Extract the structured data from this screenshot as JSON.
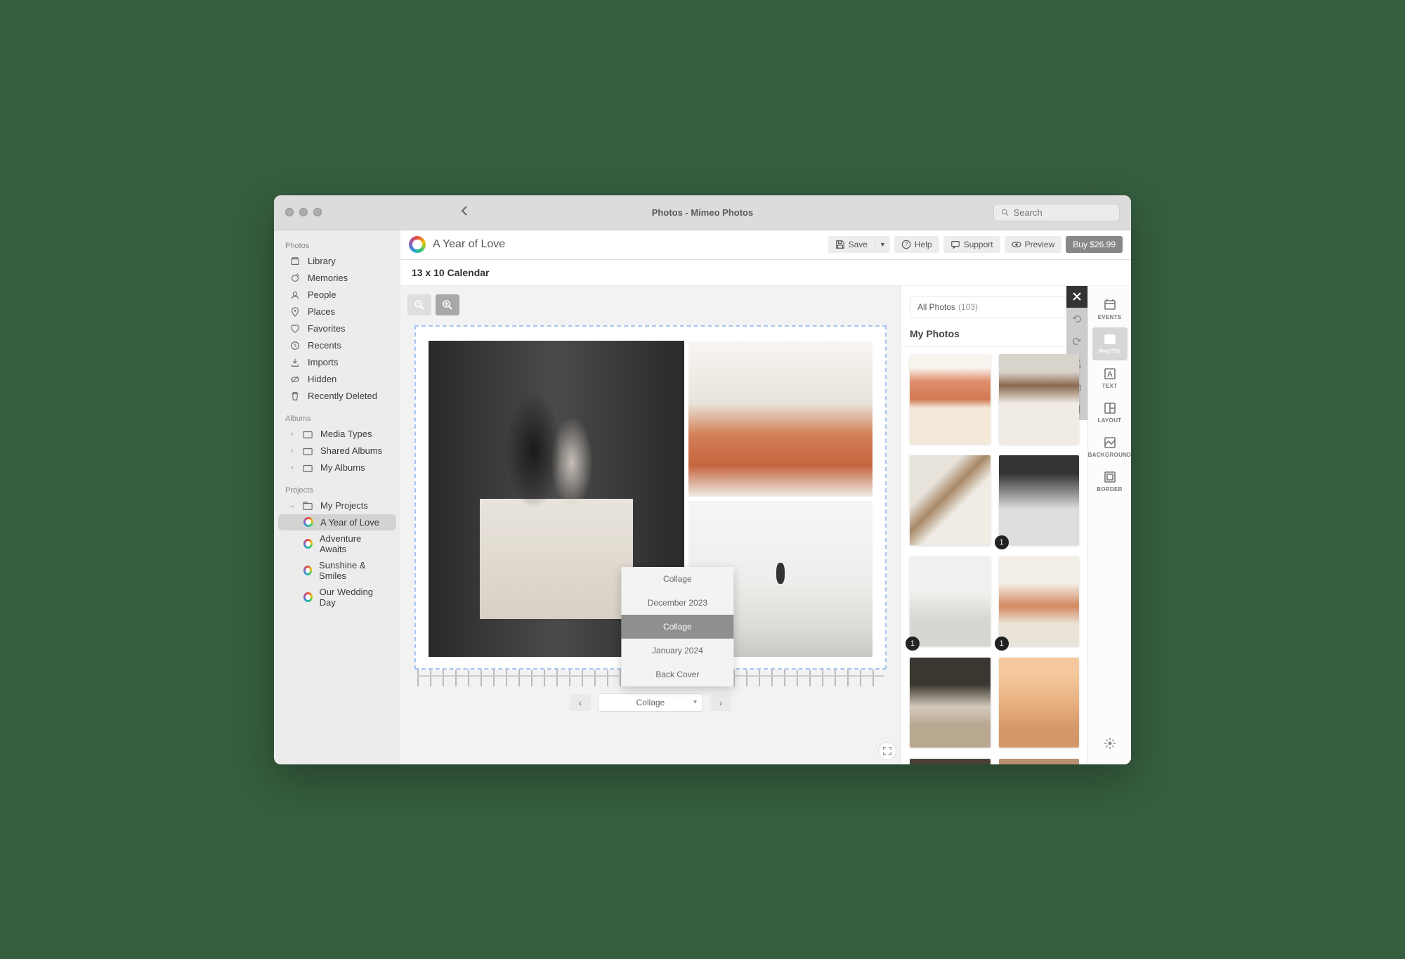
{
  "titlebar": {
    "title": "Photos - Mimeo Photos",
    "search_placeholder": "Search"
  },
  "sidebar": {
    "section_photos": "Photos",
    "photos_items": [
      {
        "label": "Library",
        "icon": "library"
      },
      {
        "label": "Memories",
        "icon": "memories"
      },
      {
        "label": "People",
        "icon": "people"
      },
      {
        "label": "Places",
        "icon": "places"
      },
      {
        "label": "Favorites",
        "icon": "heart"
      },
      {
        "label": "Recents",
        "icon": "clock"
      },
      {
        "label": "Imports",
        "icon": "import"
      },
      {
        "label": "Hidden",
        "icon": "hidden"
      },
      {
        "label": "Recently Deleted",
        "icon": "trash"
      }
    ],
    "section_albums": "Albums",
    "albums_items": [
      {
        "label": "Media Types"
      },
      {
        "label": "Shared Albums"
      },
      {
        "label": "My Albums"
      }
    ],
    "section_projects": "Projects",
    "my_projects_label": "My Projects",
    "projects": [
      {
        "label": "A Year of Love",
        "active": true
      },
      {
        "label": "Adventure Awaits"
      },
      {
        "label": "Sunshine & Smiles"
      },
      {
        "label": "Our Wedding Day"
      }
    ]
  },
  "toolbar": {
    "project_title": "A Year of Love",
    "save": "Save",
    "help": "Help",
    "support": "Support",
    "preview": "Preview",
    "buy": "Buy $26.99"
  },
  "subheader": "13 x 10 Calendar",
  "page_nav": {
    "current": "Collage",
    "options": [
      "Collage",
      "December 2023",
      "Collage",
      "January 2024",
      "Back Cover"
    ],
    "selected_index": 2
  },
  "photos_panel": {
    "dropdown_label": "All Photos",
    "dropdown_count": "(103)",
    "header": "My Photos",
    "thumbs": [
      {
        "badge": null
      },
      {
        "badge": null
      },
      {
        "badge": null
      },
      {
        "badge": "1"
      },
      {
        "badge": "1"
      },
      {
        "badge": "1"
      },
      {
        "badge": null
      },
      {
        "badge": null
      },
      {
        "badge": null
      },
      {
        "badge": null
      }
    ]
  },
  "right_tabs": [
    {
      "label": "EVENTS",
      "icon": "calendar"
    },
    {
      "label": "PHOTO",
      "icon": "photo",
      "active": true
    },
    {
      "label": "TEXT",
      "icon": "text"
    },
    {
      "label": "LAYOUT",
      "icon": "layout"
    },
    {
      "label": "BACKGROUND",
      "icon": "background"
    },
    {
      "label": "BORDER",
      "icon": "border"
    }
  ]
}
